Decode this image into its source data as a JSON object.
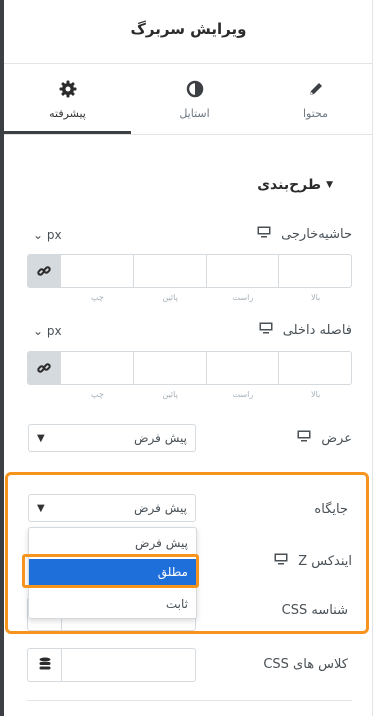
{
  "panel": {
    "title": "ویرایش سربرگ"
  },
  "tabs": [
    {
      "label": "محتوا",
      "icon": "pencil-icon"
    },
    {
      "label": "استایل",
      "icon": "contrast-icon"
    },
    {
      "label": "پیشرفته",
      "icon": "gear-icon",
      "active": true
    }
  ],
  "section": {
    "title": "طرح‌بندی"
  },
  "margin": {
    "label": "حاشیه‌خارجی",
    "unit": "px",
    "side_labels": [
      "بالا",
      "راست",
      "پائین",
      "چپ"
    ],
    "values": [
      "",
      "",
      "",
      ""
    ]
  },
  "padding": {
    "label": "فاصله داخلی",
    "unit": "px",
    "side_labels": [
      "بالا",
      "راست",
      "پائین",
      "چپ"
    ],
    "values": [
      "",
      "",
      "",
      ""
    ]
  },
  "width": {
    "label": "عرض",
    "value": "پیش فرض"
  },
  "position": {
    "label": "جایگاه",
    "value": "پیش فرض",
    "options": [
      "پیش فرض",
      "مطلق",
      "ثابت"
    ],
    "highlighted_option": "مطلق"
  },
  "zindex": {
    "label": "ایندکس Z"
  },
  "css_id": {
    "label": "شناسه CSS",
    "value": ""
  },
  "css_classes": {
    "label": "کلاس های CSS",
    "value": ""
  },
  "colors": {
    "highlight": "#f7941d",
    "selected": "#1e6fd9",
    "dark": "#3c3f43"
  }
}
